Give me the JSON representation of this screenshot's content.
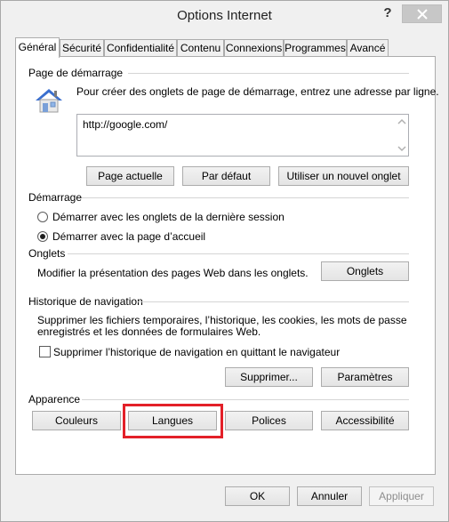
{
  "window": {
    "title": "Options Internet",
    "help_label": "?",
    "close_label": "close"
  },
  "tabs": [
    {
      "label": "Général",
      "active": true
    },
    {
      "label": "Sécurité"
    },
    {
      "label": "Confidentialité"
    },
    {
      "label": "Contenu"
    },
    {
      "label": "Connexions"
    },
    {
      "label": "Programmes"
    },
    {
      "label": "Avancé"
    }
  ],
  "homepage": {
    "group_title": "Page de démarrage",
    "description": "Pour créer des onglets de page de démarrage, entrez une adresse par ligne.",
    "url_value": "http://google.com/",
    "buttons": {
      "current": "Page actuelle",
      "default": "Par défaut",
      "new_tab": "Utiliser un nouvel onglet"
    }
  },
  "startup": {
    "group_title": "Démarrage",
    "options": [
      {
        "label": "Démarrer avec les onglets de la dernière session",
        "selected": false
      },
      {
        "label": "Démarrer avec la page d’accueil",
        "selected": true
      }
    ]
  },
  "tabs_group": {
    "group_title": "Onglets",
    "description": "Modifier la présentation des pages Web dans les onglets.",
    "button": "Onglets"
  },
  "history": {
    "group_title": "Historique de navigation",
    "description_line1": "Supprimer les fichiers temporaires, l’historique, les cookies, les mots de passe",
    "description_line2": "enregistrés et les données de formulaires Web.",
    "checkbox_label": "Supprimer l’historique de navigation en quittant le navigateur",
    "checkbox_checked": false,
    "delete_button": "Supprimer...",
    "settings_button": "Paramètres"
  },
  "appearance": {
    "group_title": "Apparence",
    "buttons": {
      "colors": "Couleurs",
      "languages": "Langues",
      "fonts": "Polices",
      "accessibility": "Accessibilité"
    },
    "highlight_color": "#e32028"
  },
  "footer": {
    "ok": "OK",
    "cancel": "Annuler",
    "apply": "Appliquer",
    "apply_disabled": true
  }
}
